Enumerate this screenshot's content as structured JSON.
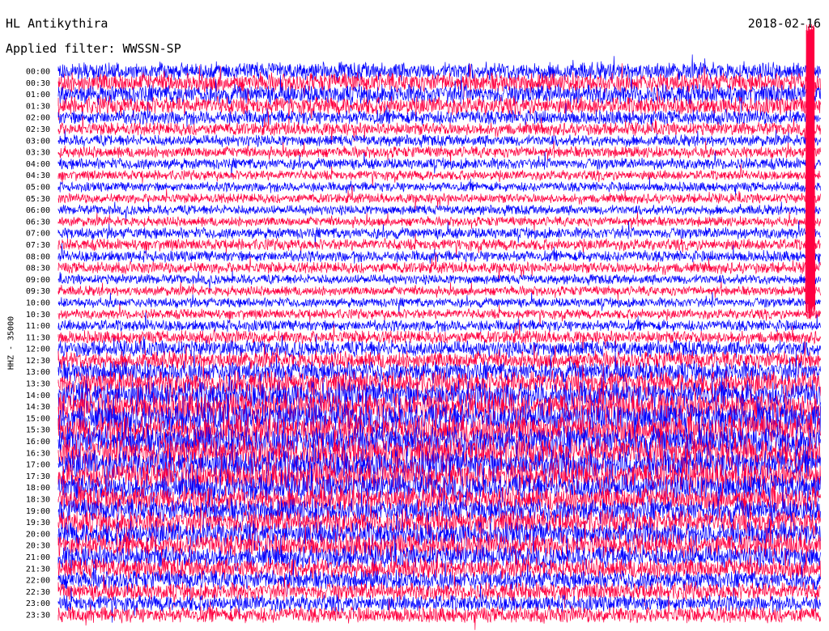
{
  "header": {
    "station": "HL Antikythira",
    "date": "2018-02-16",
    "filter": "Applied filter: WWSSN-SP"
  },
  "chart_data": {
    "type": "line",
    "title": "HL Antikythira",
    "subtitle": "Applied filter: WWSSN-SP",
    "ylabel": "HHZ - 35000",
    "xlabel": "",
    "y_tick_labels": [
      "00:00",
      "00:30",
      "01:00",
      "01:30",
      "02:00",
      "02:30",
      "03:00",
      "03:30",
      "04:00",
      "04:30",
      "05:00",
      "05:30",
      "06:00",
      "06:30",
      "07:00",
      "07:30",
      "08:00",
      "08:30",
      "09:00",
      "09:30",
      "10:00",
      "10:30",
      "11:00",
      "11:30",
      "12:00",
      "12:30",
      "13:00",
      "13:30",
      "14:00",
      "14:30",
      "15:00",
      "15:30",
      "16:00",
      "16:30",
      "17:00",
      "17:30",
      "18:00",
      "18:30",
      "19:00",
      "19:30",
      "20:00",
      "20:30",
      "21:00",
      "21:30",
      "22:00",
      "22:30",
      "23:00",
      "23:30"
    ],
    "trace_colors": [
      "#0000ff",
      "#ff0040"
    ],
    "row_noise_amplitude": [
      0.55,
      0.6,
      0.6,
      0.55,
      0.45,
      0.4,
      0.35,
      0.35,
      0.35,
      0.3,
      0.3,
      0.3,
      0.3,
      0.3,
      0.35,
      0.35,
      0.35,
      0.35,
      0.3,
      0.3,
      0.3,
      0.3,
      0.35,
      0.4,
      0.5,
      0.55,
      0.65,
      0.75,
      0.85,
      0.9,
      0.95,
      0.95,
      0.95,
      0.95,
      0.9,
      0.9,
      0.85,
      0.8,
      0.75,
      0.75,
      0.75,
      0.75,
      0.7,
      0.65,
      0.6,
      0.55,
      0.5,
      0.5
    ],
    "grid": false,
    "legend": "none"
  }
}
